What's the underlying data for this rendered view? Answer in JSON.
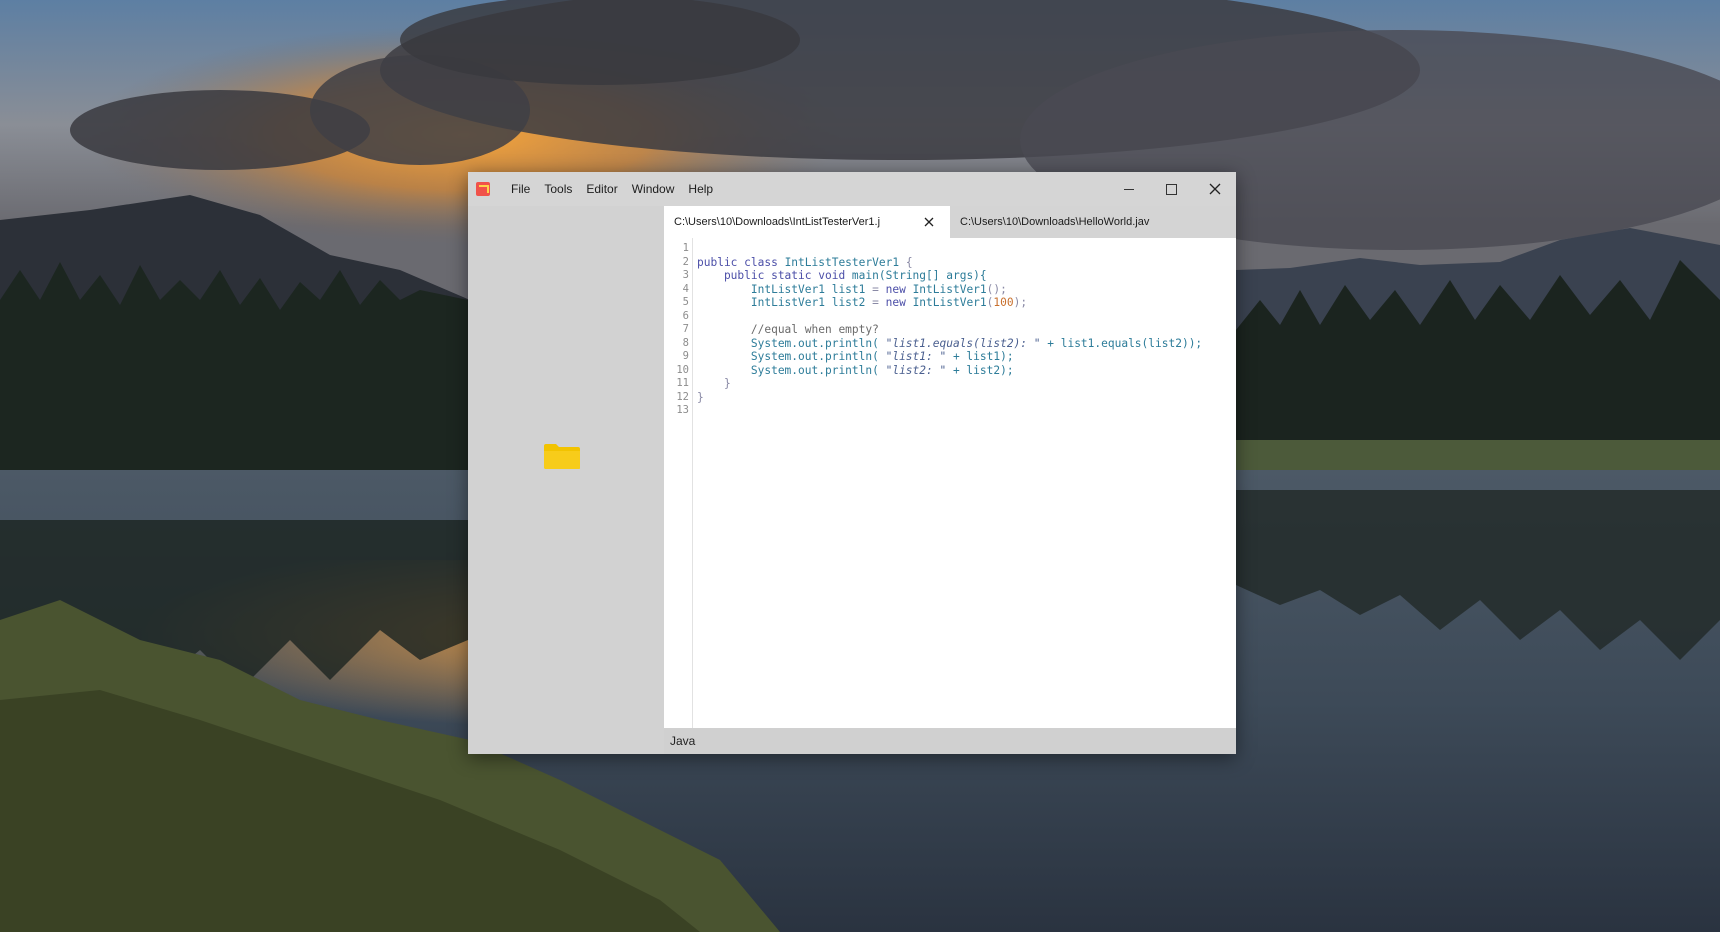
{
  "menu": [
    "File",
    "Tools",
    "Editor",
    "Window",
    "Help"
  ],
  "tabs": [
    {
      "label": "C:\\Users\\10\\Downloads\\IntListTesterVer1.j",
      "active": true
    },
    {
      "label": "C:\\Users\\10\\Downloads\\HelloWorld.jav",
      "active": false
    }
  ],
  "line_numbers": [
    "1",
    "2",
    "3",
    "4",
    "5",
    "6",
    "7",
    "8",
    "9",
    "10",
    "11",
    "12",
    "13"
  ],
  "code": {
    "l2_kw": "public class ",
    "l2_name": "IntListTesterVer1",
    "l2_brace": " {",
    "l3_kw": "    public static void ",
    "l3_main": "main(",
    "l3_type": "String",
    "l3_rest": "[] args){",
    "l4_a": "        IntListVer1 list1 ",
    "l4_eq": "=",
    "l4_new": " new ",
    "l4_b": "IntListVer1",
    "l4_c": "();",
    "l5_a": "        IntListVer1 list2 ",
    "l5_eq": "=",
    "l5_new": " new ",
    "l5_b": "IntListVer1",
    "l5_c": "(",
    "l5_num": "100",
    "l5_d": ");",
    "l7": "        //equal when empty?",
    "l8_a": "        System.out.println( ",
    "l8_str": "\"list1.equals(list2): \"",
    "l8_b": " + list1.equals(list2));",
    "l9_a": "        System.out.println( ",
    "l9_str": "\"list1: \"",
    "l9_b": " + list1);",
    "l10_a": "        System.out.println( ",
    "l10_str": "\"list2: \"",
    "l10_b": " + list2);",
    "l11": "    }",
    "l12": "}"
  },
  "status": {
    "language": "Java"
  },
  "icons": {
    "app": "app-logo-icon",
    "folder": "folder-icon",
    "close_tab": "close-icon",
    "minimize": "minimize-icon",
    "maximize": "maximize-icon",
    "close_window": "close-icon"
  },
  "colors": {
    "folder": "#f2c300",
    "app_logo": "#f0524a"
  }
}
